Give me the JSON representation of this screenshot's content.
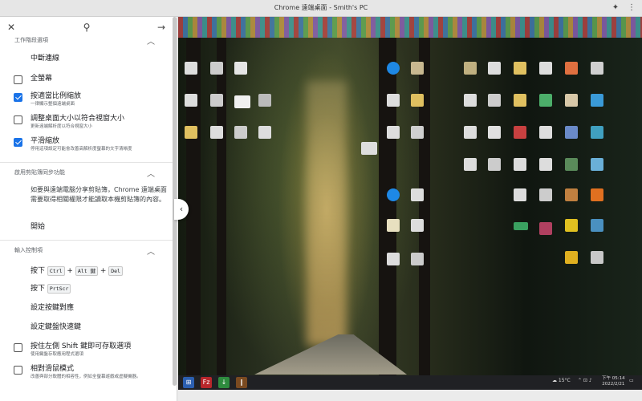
{
  "window": {
    "title": "Chrome 遠端桌面 - Smith's PC"
  },
  "panel": {
    "session": {
      "header": "工作階段選項",
      "disconnect": "中斷連線",
      "options": [
        {
          "label": "全螢幕",
          "sub": "",
          "checked": false
        },
        {
          "label": "按適當比例縮放",
          "sub": "一律顯示整個遠端桌面",
          "checked": true
        },
        {
          "label": "調整桌面大小以符合視窗大小",
          "sub": "更新遠端解析度以符合視窗大小",
          "checked": false
        },
        {
          "label": "平滑縮放",
          "sub": "停用這項設定可能會改善高解析度螢幕的文字清晰度",
          "checked": true
        }
      ]
    },
    "clipboard": {
      "header": "啟用剪貼簿同步功能",
      "description": "如要與遠端電腦分享剪貼簿，Chrome 遠端桌面需要取得相關權限才能讀取本機剪貼簿的內容。",
      "start": "開始"
    },
    "input": {
      "header": "輸入控制項",
      "press1": "按下",
      "keys1": [
        "Ctrl",
        "Alt 鍵",
        "Del"
      ],
      "press2": "按下",
      "key2": "PrtScr",
      "map_keys": "設定按鍵對應",
      "shortcuts": "設定鍵盤快速鍵",
      "options": [
        {
          "label": "按住左側 Shift 鍵即可存取選項",
          "sub": "使用鍵盤存取應用程式選項",
          "checked": false
        },
        {
          "label": "相對滑鼠模式",
          "sub": "改善與部分軟體的相容性，例如全螢幕遊戲或虛擬機器。",
          "checked": false
        }
      ]
    }
  },
  "taskbar": {
    "weather": "15°C",
    "time": "下午 05:14",
    "date": "2022/2/21"
  }
}
